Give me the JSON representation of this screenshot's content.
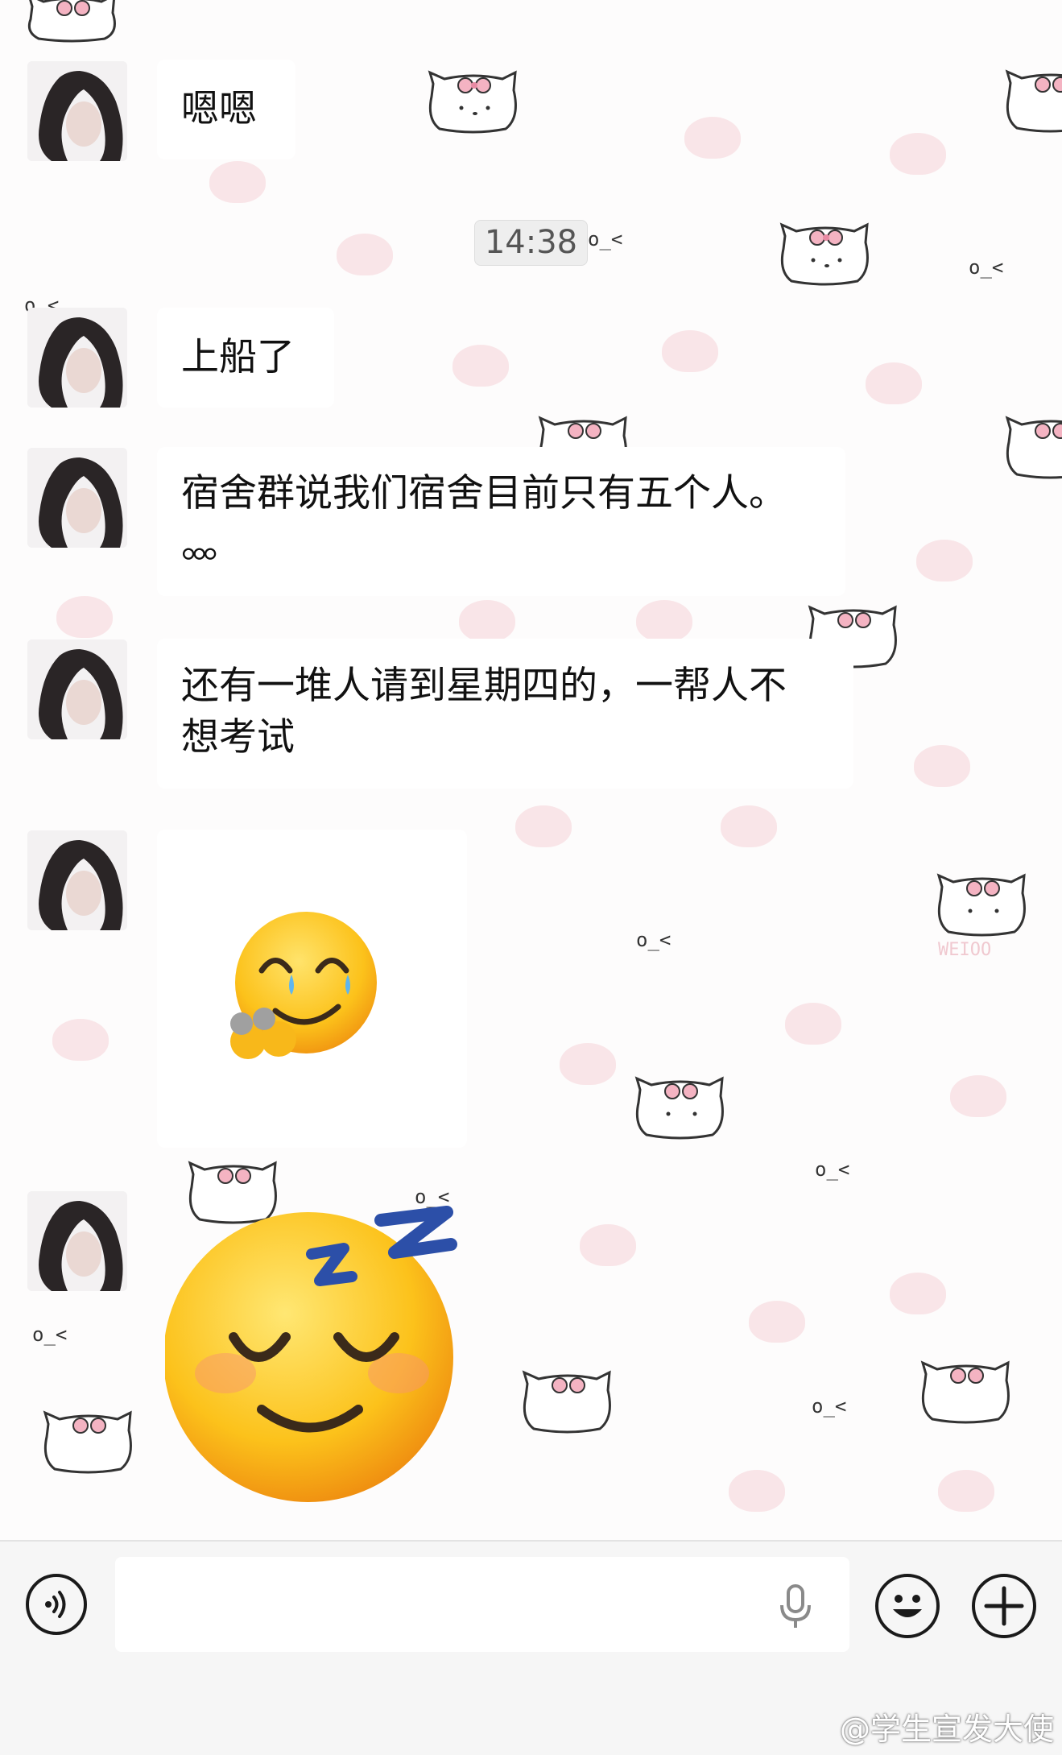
{
  "timestamp": "14:38",
  "messages": [
    {
      "type": "text",
      "text": "嗯嗯"
    },
    {
      "type": "text",
      "text": "上船了"
    },
    {
      "type": "text",
      "lines": [
        "宿舍群说我们宿舍目前只有五个人。",
        "。。。"
      ]
    },
    {
      "type": "text",
      "lines": [
        "还有一堆人请到星期四的，一帮人不",
        "想考试"
      ]
    },
    {
      "type": "sticker",
      "icon": "smiling-face-hugging-tears-emoji"
    },
    {
      "type": "sticker",
      "icon": "sleeping-face-zzz-emoji"
    }
  ],
  "background": {
    "kaomoji": "o_<",
    "kitty_watermark": "WEIOO"
  },
  "input_bar": {
    "voice_icon": "voice-mode-icon",
    "mic_icon": "microphone-icon",
    "emoji_icon": "emoji-icon",
    "plus_icon": "plus-icon",
    "input_value": ""
  },
  "watermark": "@学生宣发大使",
  "colors": {
    "bubble": "#ffffff",
    "emoji_yellow": "#fcc21b",
    "zzz_blue": "#2c4fa8",
    "heart_pink": "#f8e1e4"
  }
}
